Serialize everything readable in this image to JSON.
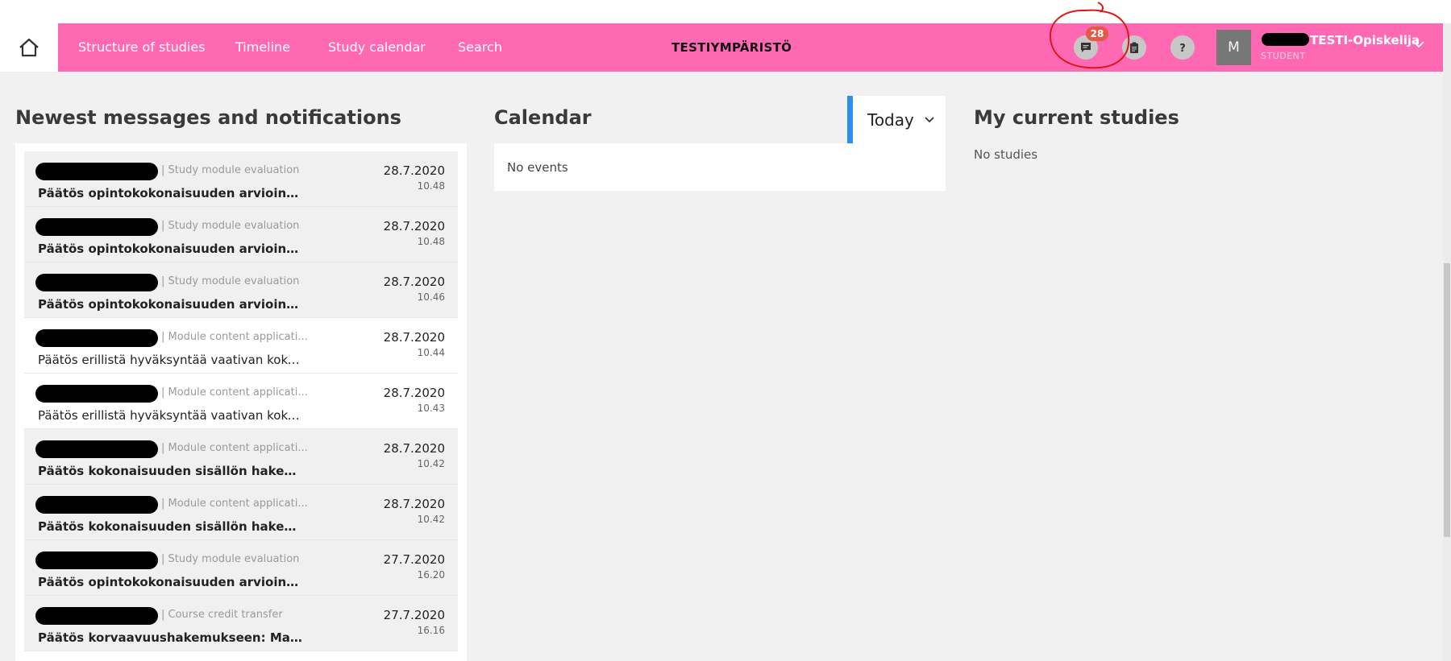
{
  "nav": {
    "links": [
      "Structure of studies",
      "Timeline",
      "Study calendar",
      "Search"
    ],
    "environment": "TESTIYMPÄRISTÖ",
    "message_badge": "28",
    "user": {
      "avatar_letter": "M",
      "name": "TESTI-Opiskelija",
      "role": "STUDENT"
    }
  },
  "messages": {
    "title": "Newest messages and notifications",
    "items": [
      {
        "category": "| Study module evaluation",
        "title": "Päätös opintokokonaisuuden arviointipyyn...",
        "date": "28.7.2020",
        "time": "10.48",
        "unread": true
      },
      {
        "category": "| Study module evaluation",
        "title": "Päätös opintokokonaisuuden arviointipyyn...",
        "date": "28.7.2020",
        "time": "10.48",
        "unread": true
      },
      {
        "category": "| Study module evaluation",
        "title": "Päätös opintokokonaisuuden arviointipyyn...",
        "date": "28.7.2020",
        "time": "10.46",
        "unread": true
      },
      {
        "category": "| Module content applicati...",
        "title": "Päätös erillistä hyväksyntää vaativan kokon...",
        "date": "28.7.2020",
        "time": "10.44",
        "unread": false
      },
      {
        "category": "| Module content applicati...",
        "title": "Päätös erillistä hyväksyntää vaativan kokon...",
        "date": "28.7.2020",
        "time": "10.43",
        "unread": false
      },
      {
        "category": "| Module content applicati...",
        "title": "Päätös kokonaisuuden sisällön hakemukse...",
        "date": "28.7.2020",
        "time": "10.42",
        "unread": true
      },
      {
        "category": "| Module content applicati...",
        "title": "Päätös kokonaisuuden sisällön hakemukse...",
        "date": "28.7.2020",
        "time": "10.42",
        "unread": true
      },
      {
        "category": "| Study module evaluation",
        "title": "Päätös opintokokonaisuuden arviointipyyn...",
        "date": "27.7.2020",
        "time": "16.20",
        "unread": true
      },
      {
        "category": "| Course credit transfer",
        "title": "Päätös korvaavuushakemukseen: Marketin...",
        "date": "27.7.2020",
        "time": "16.16",
        "unread": true
      }
    ]
  },
  "calendar": {
    "title": "Calendar",
    "today_label": "Today",
    "empty_text": "No events"
  },
  "studies": {
    "title": "My current studies",
    "empty_text": "No studies"
  },
  "colors": {
    "navbar": "#ff69b4",
    "accent": "#2d8ff0",
    "badge": "#e05a47"
  },
  "icons": [
    "home-icon",
    "message-icon",
    "clipboard-icon",
    "help-icon",
    "chevron-down-icon"
  ]
}
